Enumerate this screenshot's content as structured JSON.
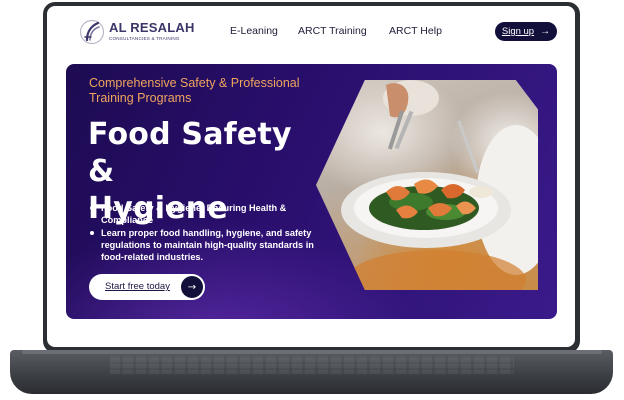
{
  "brand": {
    "name": "AL RESALAH",
    "tagline": "CONSULTANCIES & TRAINING",
    "color": "#3b3668"
  },
  "nav": {
    "links": [
      "E-Leaning",
      "ARCT Training",
      "ARCT Help"
    ],
    "signup_label": "Sign up",
    "signup_icon": "arrow-right-icon"
  },
  "hero": {
    "eyebrow": "Comprehensive Safety & Professional Training Programs",
    "title_line1": "Food Safety &",
    "title_line2": "Hygiene",
    "bullets": [
      "Food Safety & Hygiene: Ensuring Health & Compliance",
      " Learn proper food handling, hygiene, and safety regulations to maintain high-quality standards in food-related industries."
    ],
    "cta_label": "Start free today",
    "cta_icon": "arrow-right-icon",
    "image": "plated-shrimp-salad-photo",
    "colors": {
      "background": "#2a0f6e",
      "eyebrow": "#f0a45e",
      "title": "#ffffff",
      "button_dark": "#120f3a"
    }
  }
}
